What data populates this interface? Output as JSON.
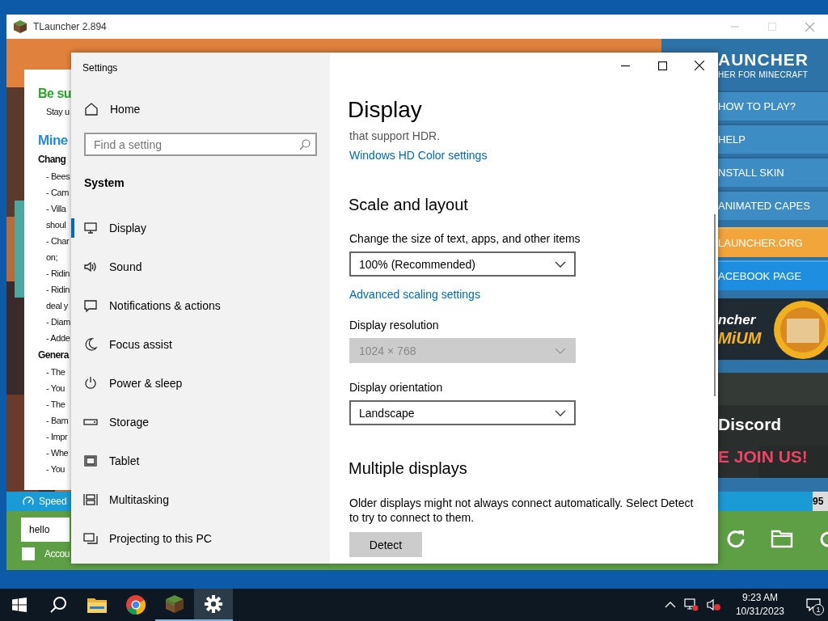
{
  "launcher": {
    "title": "TLauncher 2.894",
    "news": [
      {
        "kind": "headline",
        "text": "Be su"
      },
      {
        "kind": "text",
        "text": "Stay u"
      },
      {
        "kind": "section",
        "text": "Mine"
      },
      {
        "kind": "subheading",
        "text": "Chang"
      },
      {
        "kind": "item",
        "text": "- Bees"
      },
      {
        "kind": "item",
        "text": "- Cam"
      },
      {
        "kind": "item",
        "text": "- Villa"
      },
      {
        "kind": "item",
        "text": "shoul"
      },
      {
        "kind": "item",
        "text": "- Char"
      },
      {
        "kind": "item",
        "text": "on;"
      },
      {
        "kind": "item",
        "text": "- Ridin"
      },
      {
        "kind": "item",
        "text": "- Ridin"
      },
      {
        "kind": "item",
        "text": "deal y"
      },
      {
        "kind": "item",
        "text": "- Diam"
      },
      {
        "kind": "item",
        "text": "- Adde"
      },
      {
        "kind": "subheading",
        "text": "Genera"
      },
      {
        "kind": "item",
        "text": "- The"
      },
      {
        "kind": "item",
        "text": "- You"
      },
      {
        "kind": "item",
        "text": "- The"
      },
      {
        "kind": "item",
        "text": "- Bam"
      },
      {
        "kind": "item",
        "text": "- Impr"
      },
      {
        "kind": "item",
        "text": "- Whe"
      },
      {
        "kind": "item",
        "text": "- You"
      }
    ],
    "brand": {
      "title": "AUNCHER",
      "subtitle": "HER FOR MINECRAFT"
    },
    "menu": [
      {
        "label": "HOW TO PLAY?",
        "kind": "plain"
      },
      {
        "label": "HELP",
        "kind": "plain"
      },
      {
        "label": "NSTALL SKIN",
        "kind": "plain"
      },
      {
        "label": "ANIMATED CAPES",
        "kind": "plain"
      },
      {
        "label": "LAUNCHER.ORG",
        "kind": "orange"
      },
      {
        "label": "ACEBOOK PAGE",
        "kind": "blue"
      }
    ],
    "banners": [
      {
        "kind": "premium",
        "lines": [
          "ncher",
          "MiUM"
        ]
      },
      {
        "kind": "discord",
        "lines": [
          "Discord",
          "E JOIN US!"
        ]
      }
    ],
    "speed_label": "Speed",
    "progress_reading": "95",
    "username": {
      "value": "hello"
    },
    "account": {
      "label": "Accou",
      "checked": false
    }
  },
  "settings": {
    "title": "Settings",
    "home": "Home",
    "search": {
      "placeholder": "Find a setting"
    },
    "section": "System",
    "nav": [
      {
        "label": "Display",
        "kind": "display",
        "selected": true
      },
      {
        "label": "Sound",
        "kind": "sound",
        "selected": false
      },
      {
        "label": "Notifications & actions",
        "kind": "notifications",
        "selected": false
      },
      {
        "label": "Focus assist",
        "kind": "focus",
        "selected": false
      },
      {
        "label": "Power & sleep",
        "kind": "power",
        "selected": false
      },
      {
        "label": "Storage",
        "kind": "storage",
        "selected": false
      },
      {
        "label": "Tablet",
        "kind": "tablet",
        "selected": false
      },
      {
        "label": "Multitasking",
        "kind": "multitasking",
        "selected": false
      },
      {
        "label": "Projecting to this PC",
        "kind": "projecting",
        "selected": false
      }
    ],
    "page": {
      "title": "Display",
      "blocks": [
        {
          "kind": "text",
          "text": "that support HDR."
        },
        {
          "kind": "link",
          "text": "Windows HD Color settings"
        },
        {
          "kind": "heading",
          "text": "Scale and layout"
        },
        {
          "kind": "label",
          "text": "Change the size of text, apps, and other items"
        },
        {
          "kind": "dropdown",
          "text": "100% (Recommended)",
          "disabled": false
        },
        {
          "kind": "link",
          "text": "Advanced scaling settings"
        },
        {
          "kind": "label",
          "text": "Display resolution"
        },
        {
          "kind": "dropdown",
          "text": "1024 × 768",
          "disabled": true
        },
        {
          "kind": "label",
          "text": "Display orientation"
        },
        {
          "kind": "dropdown",
          "text": "Landscape",
          "disabled": false
        },
        {
          "kind": "heading",
          "text": "Multiple displays"
        },
        {
          "kind": "paragraph",
          "text": "Older displays might not always connect automatically. Select Detect to try to connect to them."
        },
        {
          "kind": "button",
          "text": "Detect"
        }
      ]
    }
  },
  "taskbar": {
    "apps": [
      {
        "kind": "start",
        "running": false,
        "selected": false
      },
      {
        "kind": "search",
        "running": false,
        "selected": false
      },
      {
        "kind": "explorer",
        "running": false,
        "selected": false
      },
      {
        "kind": "chrome",
        "running": false,
        "selected": false
      },
      {
        "kind": "minecraft",
        "running": true,
        "selected": false
      },
      {
        "kind": "settings",
        "running": true,
        "selected": true
      }
    ],
    "time": "9:23 AM",
    "date": "10/31/2023",
    "notifications": "1"
  }
}
